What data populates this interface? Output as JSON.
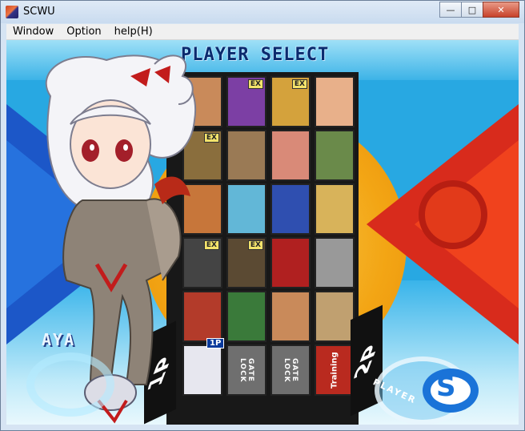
{
  "window": {
    "title": "SCWU",
    "buttons": {
      "minimize": "—",
      "maximize": "□",
      "close": "✕"
    }
  },
  "menu": {
    "items": [
      "Window",
      "Option",
      "help(H)"
    ]
  },
  "game": {
    "header": "PLAYER SELECT",
    "selected_character_name": "AYA",
    "p1_label": "1P",
    "p2_label": "2P",
    "cursor_label": "1P",
    "ex_tag": "EX",
    "gate_lock_label": "GATE LOCK",
    "training_label": "Training",
    "logo_right_letter": "S",
    "logo_right_word": "PLAYER",
    "colors": {
      "left_accent": "#1c57c8",
      "right_accent": "#d82b1c",
      "center_orange": "#f3a514"
    }
  }
}
